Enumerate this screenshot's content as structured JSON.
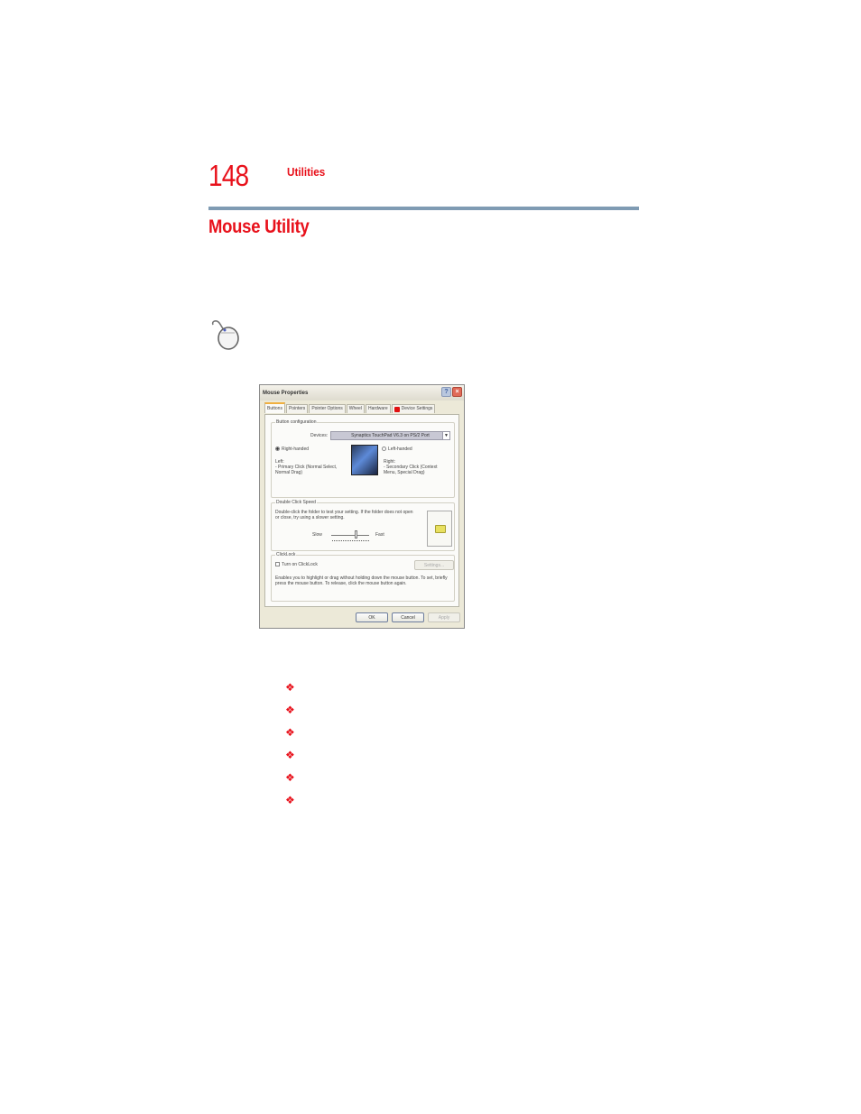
{
  "header": {
    "page_number": "148",
    "section": "Utilities"
  },
  "heading": "Mouse Utility",
  "icons": {
    "margin_icon": "mouse-icon"
  },
  "dialog": {
    "title": "Mouse Properties",
    "title_buttons": {
      "help": "?",
      "close": "×"
    },
    "tabs": [
      {
        "label": "Buttons",
        "active": true
      },
      {
        "label": "Pointers",
        "active": false
      },
      {
        "label": "Pointer Options",
        "active": false
      },
      {
        "label": "Wheel",
        "active": false
      },
      {
        "label": "Hardware",
        "active": false
      },
      {
        "label": "Device Settings",
        "active": false,
        "icon": "synaptics-icon"
      }
    ],
    "button_configuration": {
      "label": "Button configuration",
      "devices_label": "Devices:",
      "devices_value": "Synaptics TouchPad V6.3 on PS/2 Port",
      "right_handed_label": "Right-handed",
      "right_handed_checked": true,
      "left_handed_label": "Left-handed",
      "left_handed_checked": false,
      "left_title": "Left:",
      "left_desc": "- Primary Click (Normal Select, Normal Drag)",
      "right_title": "Right:",
      "right_desc": "- Secondary Click (Context Menu, Special Drag)"
    },
    "double_click_speed": {
      "label": "Double Click Speed",
      "description": "Double-click the folder to test your setting.  If the folder does not open or close, try using a slower setting.",
      "slow_label": "Slow",
      "fast_label": "Fast",
      "speed_fraction": 0.7
    },
    "clicklock": {
      "label": "ClickLock",
      "checkbox_label": "Turn on ClickLock",
      "checked": false,
      "settings_button": "Settings...",
      "description": "Enables you to highlight or drag without holding down the mouse button.  To set, briefly press the mouse button.  To release, click the mouse button again."
    },
    "buttons": {
      "ok": "OK",
      "cancel": "Cancel",
      "apply": "Apply"
    }
  },
  "bullet_list": {
    "bullet_glyph": "❖",
    "count": 6,
    "items": [
      "❖",
      "❖",
      "❖",
      "❖",
      "❖",
      "❖"
    ]
  },
  "colors": {
    "accent_red": "#e8111b",
    "rule_blue": "#7f9bb3"
  }
}
